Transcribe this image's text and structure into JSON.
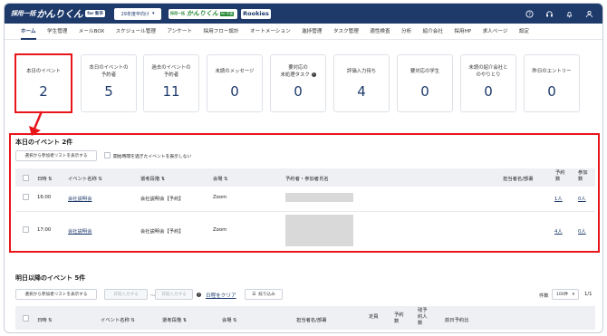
{
  "header": {
    "logo_prefix": "採用一括",
    "logo_main": "かんりくん",
    "logo_badge": "for 新卒",
    "year_select": "29年度卒向け",
    "sub_logo_prefix": "採用一括",
    "sub_logo_main": "かんりくん",
    "sub_logo_badge": "for 中途",
    "rookies": "Rookies",
    "icons": [
      "help-icon",
      "support-icon",
      "bell-icon",
      "user-icon"
    ]
  },
  "nav": {
    "tabs": [
      "ホーム",
      "学生管理",
      "メールBOX",
      "スケジュール管理",
      "アンケート",
      "採用フロー設計",
      "オートメーション",
      "進捗管理",
      "タスク管理",
      "適性検査",
      "分析",
      "紹介会社",
      "採用HP",
      "求人ページ",
      "設定"
    ],
    "active": "ホーム"
  },
  "stats": [
    {
      "label": "本日のイベント",
      "value": "2"
    },
    {
      "label": "本日のイベントの\n予約者",
      "value": "5"
    },
    {
      "label": "過去のイベントの\n予約者",
      "value": "11"
    },
    {
      "label": "未読のメッセージ",
      "value": "0"
    },
    {
      "label": "要対応の\n未処理タスク",
      "value": "0"
    },
    {
      "label": "評価入力待ち",
      "value": "4"
    },
    {
      "label": "要対応の学生",
      "value": "0"
    },
    {
      "label": "未読の紹介会社と\nのやりとり",
      "value": "0"
    },
    {
      "label": "昨日のエントリー",
      "value": "0"
    }
  ],
  "today": {
    "title": "本日のイベント 2件",
    "show_list_button": "選択から参加者リストを表示する",
    "hide_past_label": "開始時間を過ぎたイベントを表示しない",
    "columns": [
      "日時",
      "イベント名称",
      "選考段階",
      "会場",
      "予約者・参加者氏名",
      "担当者名/部署",
      "予約\n数",
      "参加\n数"
    ],
    "rows": [
      {
        "time": "16:00",
        "event": "会社説明会",
        "stage": "会社説明会【予約】",
        "venue": "Zoom",
        "reserved": "1人",
        "attended": "0人"
      },
      {
        "time": "17:00",
        "event": "会社説明会",
        "stage": "会社説明会【予約】",
        "venue": "Zoom",
        "reserved": "4人",
        "attended": "0人"
      }
    ]
  },
  "upcoming": {
    "title": "明日以降のイベント 5件",
    "show_list_button": "選択から参加者リストを表示する",
    "date_from_placeholder": "日程入力する",
    "date_to_placeholder": "日程入力する",
    "date_sep": "〜",
    "clear_link": "日程をクリア",
    "filter_button": "絞り込み",
    "count_label": "件数",
    "per_page": "100件",
    "pager": "1/1",
    "columns": [
      "日時",
      "イベント名称",
      "選考段階",
      "会場",
      "担当者名/部署",
      "定員",
      "予約\n数",
      "残予\n約人\n数",
      "前日予約比"
    ]
  }
}
